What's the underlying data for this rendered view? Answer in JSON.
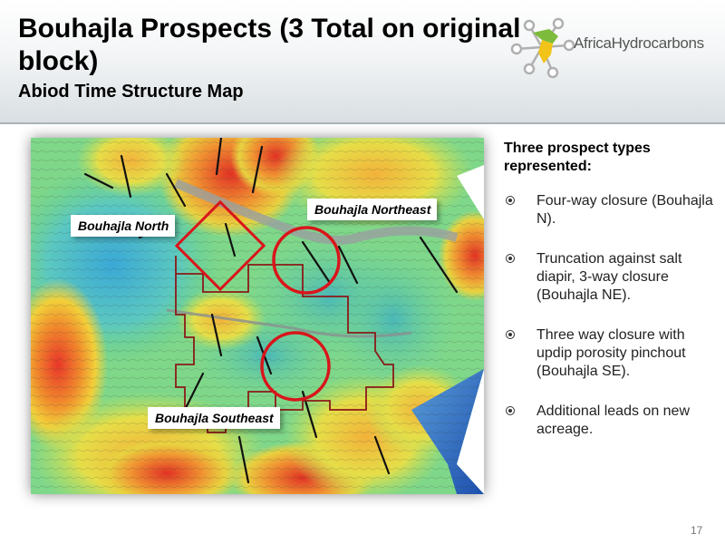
{
  "slide": {
    "title": "Bouhajla Prospects (3 Total on original block)",
    "subtitle": "Abiod Time Structure Map",
    "page_number": "17"
  },
  "logo": {
    "text": "AfricaHydrocarbons",
    "icon": "africa-network-icon",
    "colors": {
      "green": "#7dbb3c",
      "yellow": "#f2c318",
      "node": "#b0b0b0"
    }
  },
  "map": {
    "labels": {
      "north": "Bouhajla North",
      "northeast": "Bouhajla Northeast",
      "southeast": "Bouhajla Southeast"
    },
    "colors": {
      "prospect_outline": "#d9151b",
      "block_outline": "#8b1a1a",
      "fault": "#111111"
    }
  },
  "panel": {
    "heading": "Three prospect types represented:",
    "bullets": [
      {
        "text": "Four-way closure (Bouhajla N)."
      },
      {
        "text": "Truncation against salt diapir, 3-way closure (Bouhajla NE)."
      },
      {
        "text": "Three way closure with updip porosity pinchout (Bouhajla SE)."
      },
      {
        "text": "Additional leads on new acreage."
      }
    ]
  }
}
